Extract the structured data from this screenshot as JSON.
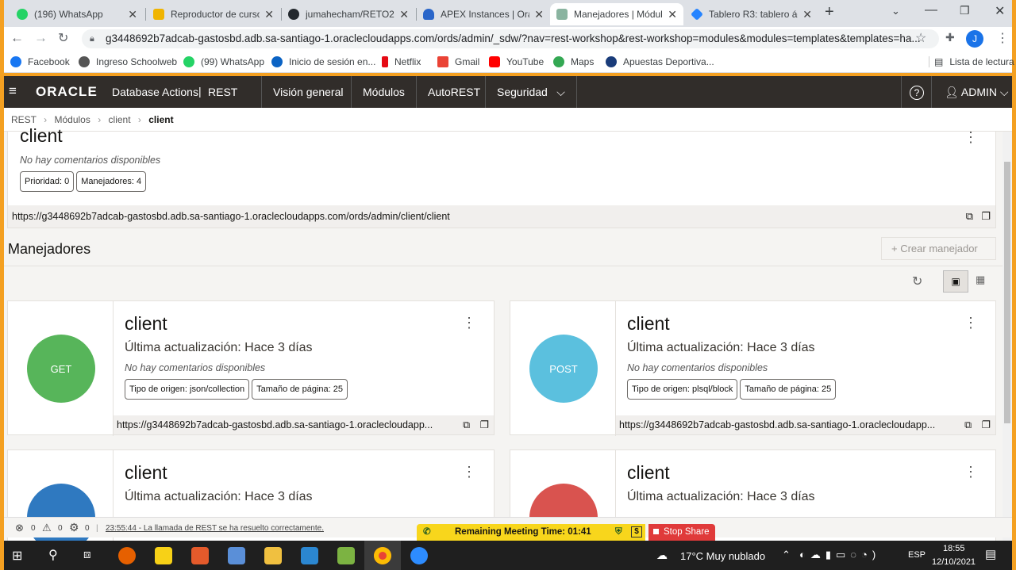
{
  "browser": {
    "tabs": [
      {
        "label": "(196) WhatsApp",
        "icon": "whatsapp-icon",
        "color": "#25d366"
      },
      {
        "label": "Reproductor de cursos",
        "icon": "course-icon",
        "color": "#f0b400"
      },
      {
        "label": "jumahecham/RETO2:",
        "icon": "github-icon",
        "color": "#24292e"
      },
      {
        "label": "APEX Instances | Orac",
        "icon": "cloud-icon",
        "color": "#2a66c9"
      },
      {
        "label": "Manejadores | Módul",
        "icon": "oracle-icon",
        "color": "#8ab4a0"
      },
      {
        "label": "Tablero R3: tablero ág",
        "icon": "jira-icon",
        "color": "#2684ff"
      }
    ],
    "url": "g3448692b7adcab-gastosbd.adb.sa-santiago-1.oraclecloudapps.com/ords/admin/_sdw/?nav=rest-workshop&rest-workshop=modules&modules=templates&templates=ha...",
    "profile_initial": "J",
    "bookmarks": [
      {
        "label": "Facebook",
        "color": "#1877f2"
      },
      {
        "label": "Ingreso Schoolweb",
        "color": "#555"
      },
      {
        "label": "(99) WhatsApp",
        "color": "#25d366"
      },
      {
        "label": "Inicio de sesión en...",
        "color": "#0b63c4"
      },
      {
        "label": "Netflix",
        "color": "#e50914"
      },
      {
        "label": "Gmail",
        "color": "#ea4335"
      },
      {
        "label": "YouTube",
        "color": "#ff0000"
      },
      {
        "label": "Maps",
        "color": "#34a853"
      },
      {
        "label": "Apuestas Deportiva...",
        "color": "#1a3c7a"
      }
    ],
    "reading_list": "Lista de lectura"
  },
  "header": {
    "brand": "ORACLE",
    "product": "Database Actions",
    "separator": "|",
    "section": "REST",
    "nav": [
      "Visión general",
      "Módulos",
      "AutoREST",
      "Seguridad"
    ],
    "user": "ADMIN"
  },
  "breadcrumb": [
    "REST",
    "Módulos",
    "client",
    "client"
  ],
  "template": {
    "name": "client",
    "comments": "No hay comentarios disponibles",
    "priority": "Prioridad: 0",
    "handlers": "Manejadores: 4",
    "url": "https://g3448692b7adcab-gastosbd.adb.sa-santiago-1.oraclecloudapps.com/ords/admin/client/client"
  },
  "handlers_section": {
    "title": "Manejadores",
    "create_button": "Crear manejador"
  },
  "handlers": [
    {
      "method": "GET",
      "color": "#57b55a",
      "name": "client",
      "updated": "Última actualización: Hace 3 días",
      "comments": "No hay comentarios disponibles",
      "source": "Tipo de origen: json/collection",
      "page": "Tamaño de página: 25",
      "url": "https://g3448692b7adcab-gastosbd.adb.sa-santiago-1.oraclecloudapp..."
    },
    {
      "method": "POST",
      "color": "#5bc0de",
      "name": "client",
      "updated": "Última actualización: Hace 3 días",
      "comments": "No hay comentarios disponibles",
      "source": "Tipo de origen: plsql/block",
      "page": "Tamaño de página: 25",
      "url": "https://g3448692b7adcab-gastosbd.adb.sa-santiago-1.oraclecloudapp..."
    },
    {
      "method": "",
      "color": "#2f79c0",
      "name": "client",
      "updated": "Última actualización: Hace 3 días"
    },
    {
      "method": "",
      "color": "#d9534f",
      "name": "client",
      "updated": "Última actualización: Hace 3 días"
    }
  ],
  "status": {
    "errors": "0",
    "warnings": "0",
    "settings": "0",
    "sep": "|",
    "message": "23:55:44 - La llamada de REST se ha resuelto correctamente."
  },
  "meeting": {
    "remaining": "Remaining Meeting Time: 01:41",
    "stop": "Stop Share"
  },
  "taskbar": {
    "weather": "17°C  Muy nublado",
    "lang": "ESP",
    "time": "18:55",
    "date": "12/10/2021"
  }
}
